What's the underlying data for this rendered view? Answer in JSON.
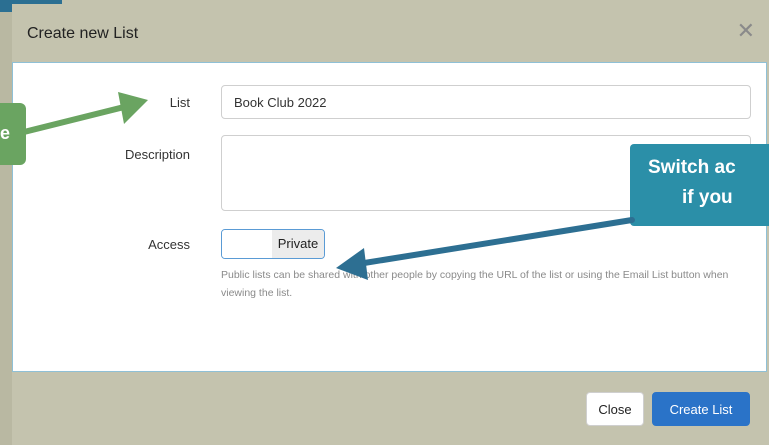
{
  "modal": {
    "title": "Create new List",
    "close_icon": "close-icon"
  },
  "form": {
    "list_label": "List",
    "list_value": "Book Club 2022",
    "description_label": "Description",
    "description_value": "",
    "access_label": "Access",
    "access_value": "Private",
    "help_text": "Public lists can be shared with other people by copying the URL of the list or using the Email List button when viewing the list."
  },
  "footer": {
    "close_label": "Close",
    "create_label": "Create List"
  },
  "annotations": {
    "left_callout_text": "e",
    "right_callout_line1": "Switch ac",
    "right_callout_line2": "if you"
  },
  "colors": {
    "header_bg": "#c4c3ae",
    "primary_button": "#2a73c8",
    "left_callout": "#6aa461",
    "right_callout": "#2b8fa8",
    "arrow_right": "#2d6f92",
    "arrow_left": "#6aa461"
  }
}
